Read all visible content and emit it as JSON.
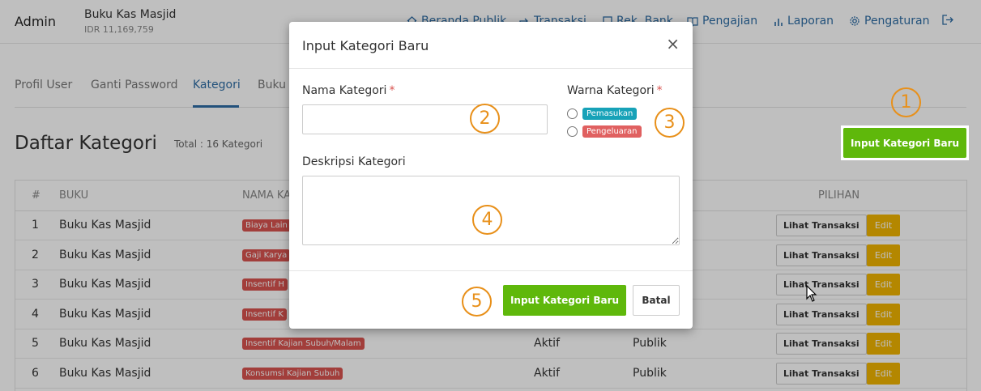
{
  "header": {
    "brand": "Admin",
    "book_name": "Buku Kas Masjid",
    "book_balance": "IDR 11,169,759",
    "nav": [
      {
        "label": "Beranda Publik",
        "icon": "home-icon"
      },
      {
        "label": "Transaksi",
        "icon": "share-icon"
      },
      {
        "label": "Rek. Bank",
        "icon": "book-icon"
      },
      {
        "label": "Pengajian",
        "icon": "open-book-icon"
      },
      {
        "label": "Laporan",
        "icon": "bar-chart-icon"
      },
      {
        "label": "Pengaturan",
        "icon": "gear-icon"
      }
    ],
    "logout_icon": "logout-icon"
  },
  "tabs": [
    "Profil User",
    "Ganti Password",
    "Kategori",
    "Buku"
  ],
  "active_tab": "Kategori",
  "page": {
    "title": "Daftar Kategori",
    "total": "Total : 16 Kategori",
    "add_button": "Input Kategori Baru"
  },
  "table": {
    "headers": [
      "#",
      "BUKU",
      "NAMA KATEGORI",
      "PILIHAN"
    ],
    "rows": [
      {
        "no": "1",
        "book": "Buku Kas Masjid",
        "category": "Biaya Lain",
        "status": "",
        "visibility": ""
      },
      {
        "no": "2",
        "book": "Buku Kas Masjid",
        "category": "Gaji Karya",
        "status": "",
        "visibility": ""
      },
      {
        "no": "3",
        "book": "Buku Kas Masjid",
        "category": "Insentif H",
        "status": "",
        "visibility": ""
      },
      {
        "no": "4",
        "book": "Buku Kas Masjid",
        "category": "Insentif K",
        "status": "",
        "visibility": ""
      },
      {
        "no": "5",
        "book": "Buku Kas Masjid",
        "category": "Insentif Kajian Subuh/Malam",
        "status": "Aktif",
        "visibility": "Publik"
      },
      {
        "no": "6",
        "book": "Buku Kas Masjid",
        "category": "Konsumsi Kajian Subuh",
        "status": "Aktif",
        "visibility": "Publik"
      }
    ],
    "view_label": "Lihat Transaksi",
    "edit_label": "Edit"
  },
  "modal": {
    "title": "Input Kategori Baru",
    "close": "×",
    "name_label": "Nama Kategori",
    "color_label": "Warna Kategori",
    "required_mark": "*",
    "name_value": "",
    "color_options": [
      {
        "label": "Pemasukan",
        "color": "#17a2b8"
      },
      {
        "label": "Pengeluaran",
        "color": "#e06060"
      }
    ],
    "desc_label": "Deskripsi Kategori",
    "desc_value": "",
    "save_label": "Input Kategori Baru",
    "cancel_label": "Batal"
  },
  "steps": [
    "1",
    "2",
    "3",
    "4",
    "5"
  ],
  "colors": {
    "primary": "#2e6da4",
    "success": "#5fb80b",
    "danger": "#d9534f",
    "warning": "#f0b400",
    "info": "#17a2b8",
    "step": "#e8901a"
  }
}
